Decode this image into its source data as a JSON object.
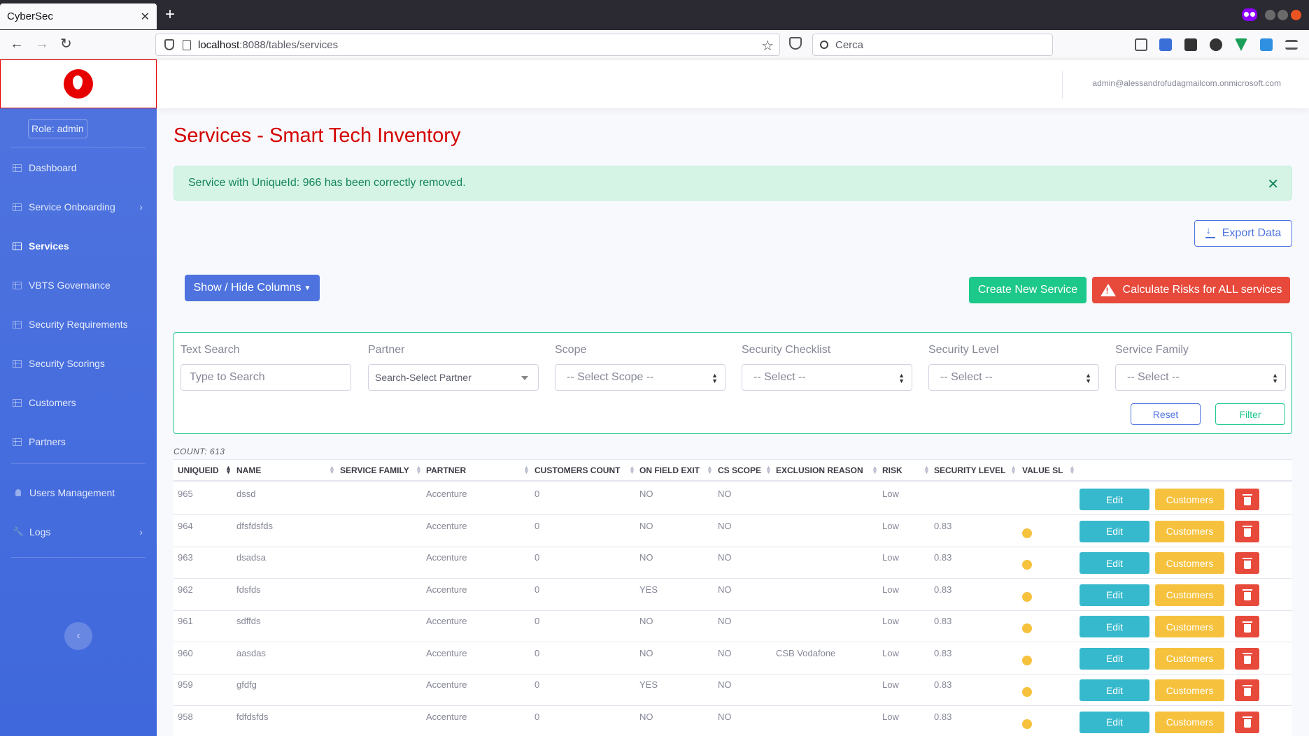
{
  "browser": {
    "tab_title": "CyberSec",
    "url_host": "localhost",
    "url_rest": ":8088/tables/services",
    "search_placeholder": "Cerca"
  },
  "sidebar": {
    "role": "Role: admin",
    "items": [
      {
        "label": "Dashboard",
        "icon": "table-icon"
      },
      {
        "label": "Service Onboarding",
        "icon": "table-icon",
        "chevron": true
      },
      {
        "label": "Services",
        "icon": "table-icon",
        "active": true
      },
      {
        "label": "VBTS Governance",
        "icon": "table-icon"
      },
      {
        "label": "Security Requirements",
        "icon": "table-icon"
      },
      {
        "label": "Security Scorings",
        "icon": "table-icon"
      },
      {
        "label": "Customers",
        "icon": "table-icon"
      },
      {
        "label": "Partners",
        "icon": "table-icon"
      },
      {
        "label": "Users Management",
        "icon": "users-icon"
      },
      {
        "label": "Logs",
        "icon": "wrench-icon",
        "chevron": true
      }
    ]
  },
  "topbar": {
    "user": "admin@alessandrofudagmailcom.onmicrosoft.com"
  },
  "page": {
    "title": "Services - Smart Tech Inventory",
    "alert": "Service with UniqueId: 966 has been correctly removed.",
    "export_label": "Export Data",
    "columns_label": "Show / Hide Columns",
    "create_label": "Create New Service",
    "calc_label": "Calculate Risks for ALL services"
  },
  "filters": {
    "text_label": "Text Search",
    "text_placeholder": "Type to Search",
    "partner_label": "Partner",
    "partner_value": "Search-Select Partner",
    "scope_label": "Scope",
    "scope_value": "-- Select Scope --",
    "checklist_label": "Security Checklist",
    "checklist_value": "-- Select --",
    "level_label": "Security Level",
    "level_value": "-- Select --",
    "family_label": "Service Family",
    "family_value": "-- Select --",
    "reset_label": "Reset",
    "filter_label": "Filter"
  },
  "table": {
    "count": "COUNT: 613",
    "headers": [
      "UNIQUEID",
      "NAME",
      "SERVICE FAMILY",
      "PARTNER",
      "CUSTOMERS COUNT",
      "ON FIELD EXIT",
      "CS SCOPE",
      "EXCLUSION REASON",
      "RISK",
      "SECURITY LEVEL",
      "VALUE SL"
    ],
    "edit_label": "Edit",
    "customers_label": "Customers",
    "rows": [
      {
        "id": "965",
        "name": "dssd",
        "family": "",
        "partner": "Accenture",
        "customers": "0",
        "exit": "NO",
        "scope": "NO",
        "reason": "",
        "risk": "Low",
        "level": "",
        "dot": false
      },
      {
        "id": "964",
        "name": "dfsfdsfds",
        "family": "",
        "partner": "Accenture",
        "customers": "0",
        "exit": "NO",
        "scope": "NO",
        "reason": "",
        "risk": "Low",
        "level": "0.83",
        "dot": true
      },
      {
        "id": "963",
        "name": "dsadsa",
        "family": "",
        "partner": "Accenture",
        "customers": "0",
        "exit": "NO",
        "scope": "NO",
        "reason": "",
        "risk": "Low",
        "level": "0.83",
        "dot": true
      },
      {
        "id": "962",
        "name": "fdsfds",
        "family": "",
        "partner": "Accenture",
        "customers": "0",
        "exit": "YES",
        "scope": "NO",
        "reason": "",
        "risk": "Low",
        "level": "0.83",
        "dot": true
      },
      {
        "id": "961",
        "name": "sdffds",
        "family": "",
        "partner": "Accenture",
        "customers": "0",
        "exit": "NO",
        "scope": "NO",
        "reason": "",
        "risk": "Low",
        "level": "0.83",
        "dot": true
      },
      {
        "id": "960",
        "name": "aasdas",
        "family": "",
        "partner": "Accenture",
        "customers": "0",
        "exit": "NO",
        "scope": "NO",
        "reason": "CSB Vodafone",
        "risk": "Low",
        "level": "0.83",
        "dot": true
      },
      {
        "id": "959",
        "name": "gfdfg",
        "family": "",
        "partner": "Accenture",
        "customers": "0",
        "exit": "YES",
        "scope": "NO",
        "reason": "",
        "risk": "Low",
        "level": "0.83",
        "dot": true
      },
      {
        "id": "958",
        "name": "fdfdsfds",
        "family": "",
        "partner": "Accenture",
        "customers": "0",
        "exit": "NO",
        "scope": "NO",
        "reason": "",
        "risk": "Low",
        "level": "0.83",
        "dot": true
      }
    ]
  }
}
